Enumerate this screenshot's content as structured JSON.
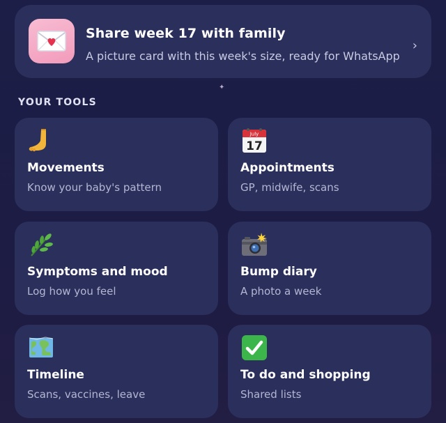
{
  "share": {
    "title": "Share week 17 with family",
    "subtitle": "A picture card with this week's size, ready for WhatsApp",
    "icon": "envelope-heart-icon",
    "chevron": "›"
  },
  "section": {
    "heading": "YOUR TOOLS"
  },
  "tools": [
    {
      "title": "Movements",
      "subtitle": "Know your baby's pattern",
      "icon": "foot-icon"
    },
    {
      "title": "Appointments",
      "subtitle": "GP, midwife, scans",
      "icon": "calendar-icon",
      "calendar_month": "July",
      "calendar_day": "17"
    },
    {
      "title": "Symptoms and mood",
      "subtitle": "Log how you feel",
      "icon": "leaf-icon"
    },
    {
      "title": "Bump diary",
      "subtitle": "A photo a week",
      "icon": "camera-flash-icon"
    },
    {
      "title": "Timeline",
      "subtitle": "Scans, vaccines, leave",
      "icon": "map-icon"
    },
    {
      "title": "To do and shopping",
      "subtitle": "Shared lists",
      "icon": "check-mark-icon"
    }
  ],
  "colors": {
    "background": "#1e1f45",
    "card": "#2b2f5c",
    "subtitle_text": "#b4b7d3",
    "share_icon_bg": "#f4a9c5",
    "check_green": "#3cb54a"
  }
}
